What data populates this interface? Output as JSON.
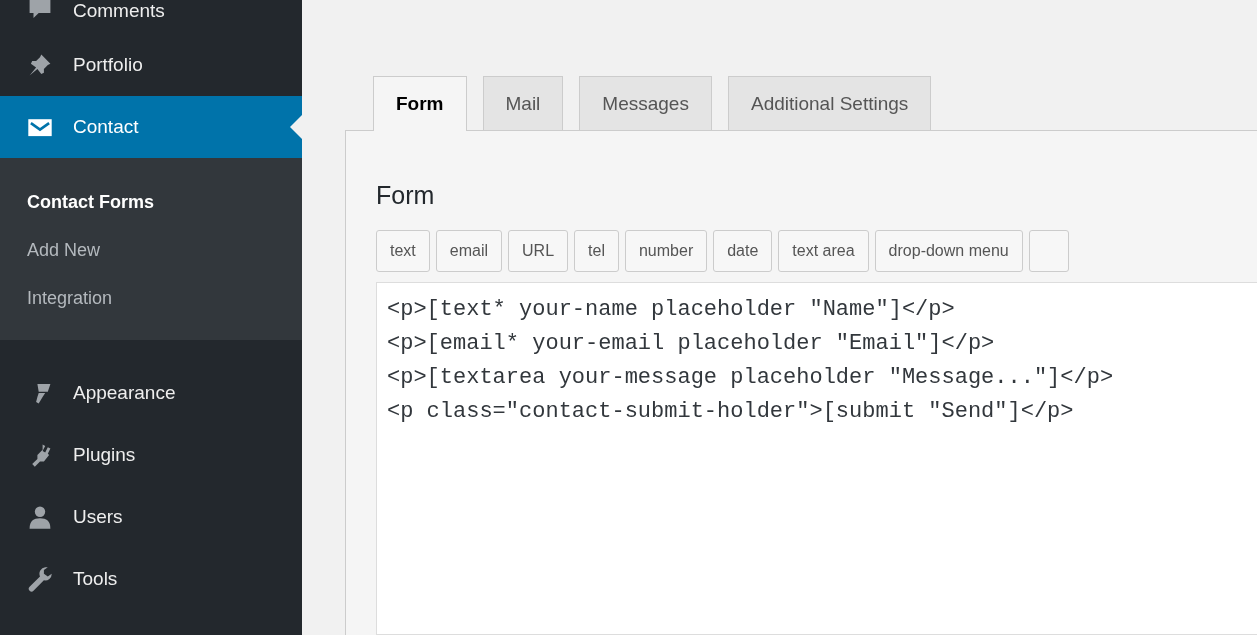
{
  "sidebar": {
    "items": [
      {
        "label": "Comments",
        "selected": false
      },
      {
        "label": "Portfolio",
        "selected": false
      },
      {
        "label": "Contact",
        "selected": true,
        "submenu": [
          {
            "label": "Contact Forms",
            "selected": true
          },
          {
            "label": "Add New",
            "selected": false
          },
          {
            "label": "Integration",
            "selected": false
          }
        ]
      },
      {
        "label": "Appearance",
        "selected": false
      },
      {
        "label": "Plugins",
        "selected": false
      },
      {
        "label": "Users",
        "selected": false
      },
      {
        "label": "Tools",
        "selected": false
      }
    ]
  },
  "tabs": [
    {
      "label": "Form",
      "selected": true
    },
    {
      "label": "Mail",
      "selected": false
    },
    {
      "label": "Messages",
      "selected": false
    },
    {
      "label": "Additional Settings",
      "selected": false
    }
  ],
  "section_title": "Form",
  "tag_buttons": [
    "text",
    "email",
    "URL",
    "tel",
    "number",
    "date",
    "text area",
    "drop-down menu"
  ],
  "editor": {
    "lines": [
      "<p>[text* your-name placeholder \"Name\"]</p>",
      "<p>[email* your-email placeholder \"Email\"]</p>",
      "<p>[textarea your-message placeholder \"Message...\"]</p>",
      "<p class=\"contact-submit-holder\">[submit \"Send\"]</p>"
    ]
  }
}
